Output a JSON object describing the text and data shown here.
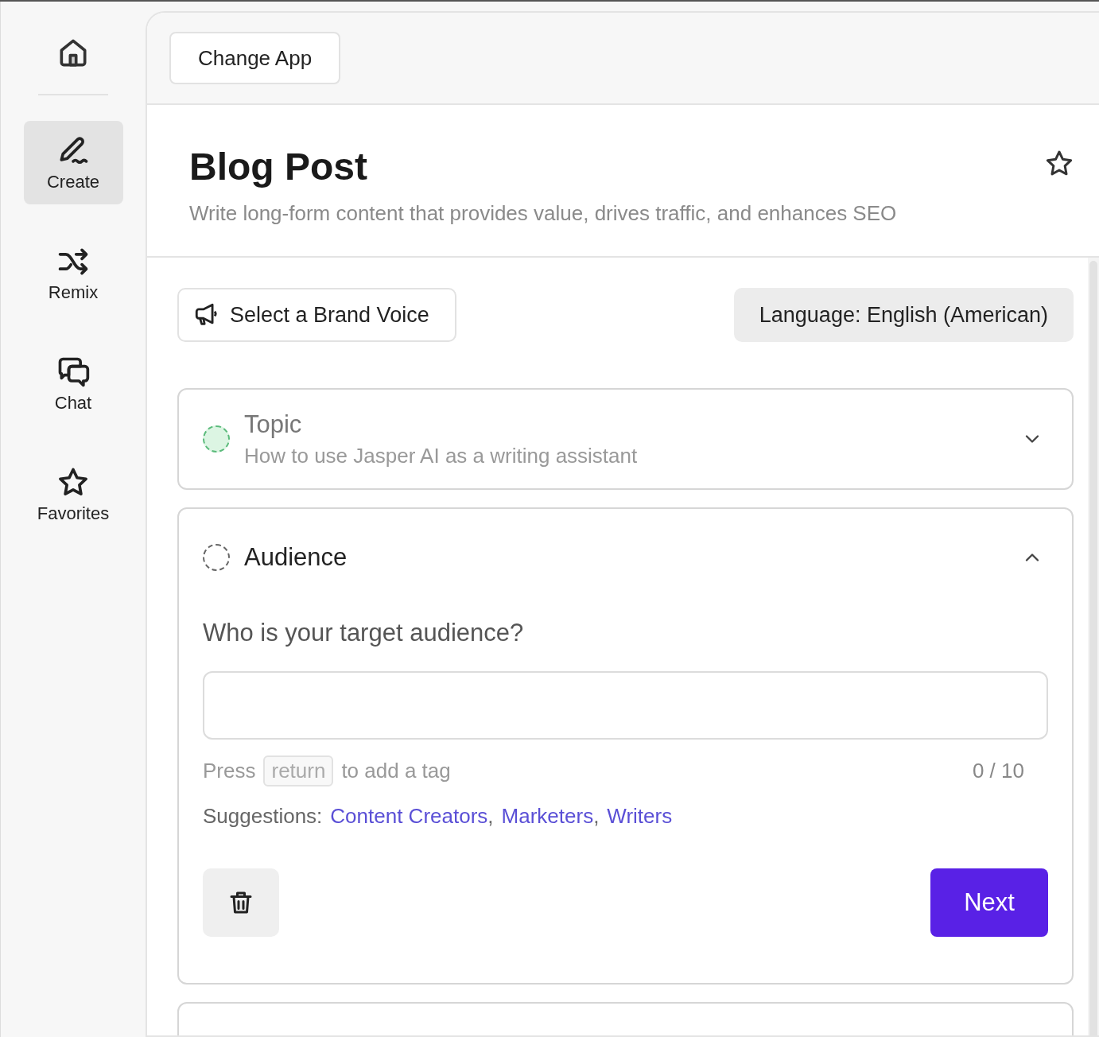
{
  "sidebar": {
    "items": [
      {
        "label": "Create",
        "kind": "pen",
        "selected": true
      },
      {
        "label": "Remix",
        "kind": "shuffle",
        "selected": false
      },
      {
        "label": "Chat",
        "kind": "chat",
        "selected": false
      },
      {
        "label": "Favorites",
        "kind": "star",
        "selected": false
      }
    ]
  },
  "header": {
    "change_app": "Change App"
  },
  "template": {
    "title": "Blog Post",
    "description": "Write long-form content that provides value, drives traffic, and enhances SEO",
    "favorited": false
  },
  "toolbar": {
    "brand_voice": "Select a Brand Voice",
    "language": "Language: English (American)"
  },
  "steps": [
    {
      "title": "Topic",
      "value": "How to use Jasper AI as a writing assistant",
      "done": true,
      "expanded": false
    },
    {
      "title": "Audience",
      "done": false,
      "expanded": true,
      "question": "Who is your target audience?",
      "hint_before": "Press",
      "hint_key": "return",
      "hint_after": "to add a tag",
      "counter": "0 / 10",
      "suggestions_label": "Suggestions:",
      "suggestions": [
        {
          "label": "Content Creators",
          "separator": ","
        },
        {
          "label": "Marketers",
          "separator": ","
        },
        {
          "label": "Writers"
        }
      ],
      "next": "Next"
    }
  ]
}
